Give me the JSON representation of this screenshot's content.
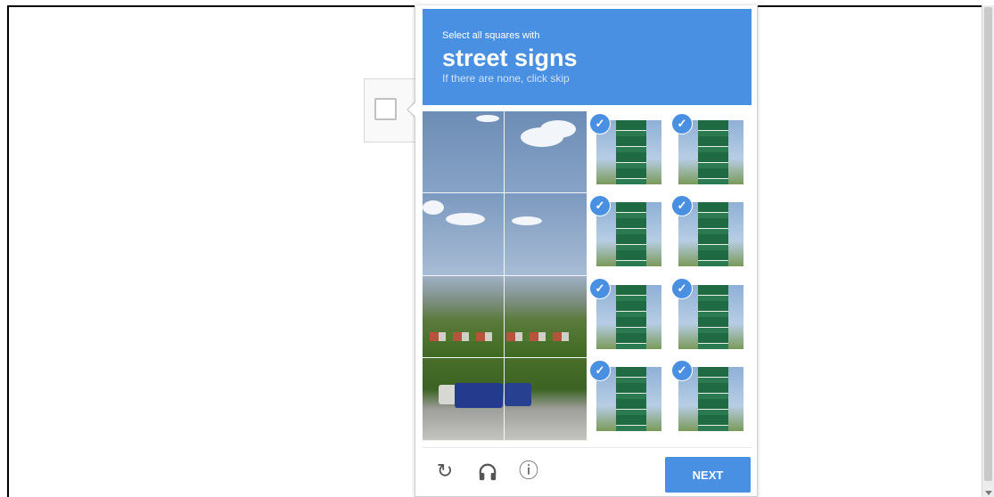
{
  "challenge": {
    "intro": "Select all squares with",
    "target": "street signs",
    "hint": "If there are none, click skip",
    "accent_color": "#4a90e2"
  },
  "right_tiles_selected": [
    true,
    true,
    true,
    true,
    true,
    true,
    true,
    true
  ],
  "check_glyph": "✓",
  "footer": {
    "reload_icon": "reload-icon",
    "audio_icon": "headphones-icon",
    "info_icon": "info-icon",
    "reload_glyph": "↻",
    "info_glyph": "ⓘ",
    "next_label": "NEXT"
  }
}
